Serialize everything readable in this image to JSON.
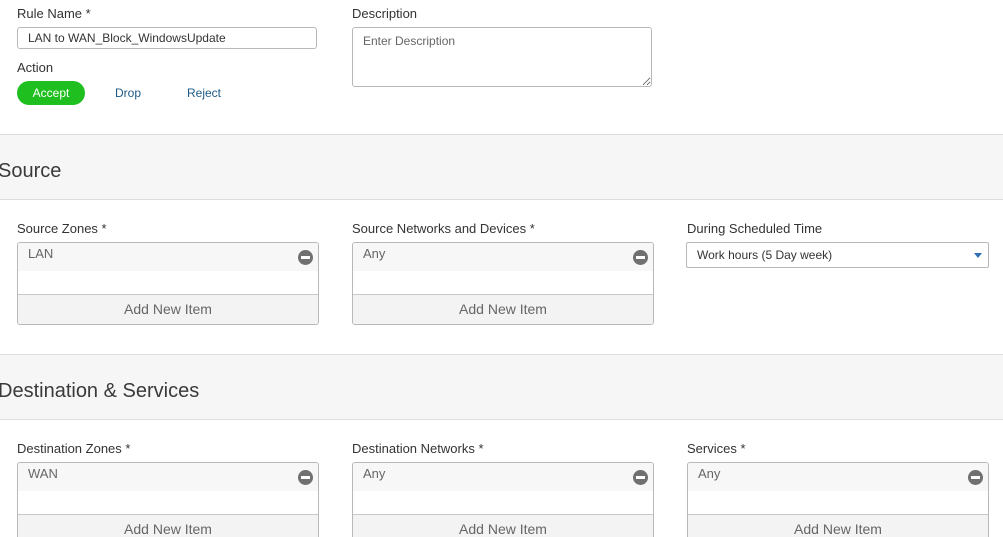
{
  "rule": {
    "name_label": "Rule Name *",
    "name_value": "LAN to WAN_Block_WindowsUpdate",
    "description_label": "Description",
    "description_placeholder": "Enter Description",
    "action_label": "Action",
    "actions": [
      "Accept",
      "Drop",
      "Reject"
    ],
    "selected_action": "Accept"
  },
  "source": {
    "title": "Source",
    "zones": {
      "label": "Source Zones *",
      "items": [
        "LAN"
      ],
      "add_label": "Add New Item"
    },
    "networks": {
      "label": "Source Networks and Devices *",
      "items": [
        "Any"
      ],
      "add_label": "Add New Item"
    },
    "schedule": {
      "label": "During Scheduled Time",
      "value": "Work hours (5 Day week)"
    }
  },
  "destination": {
    "title": "Destination & Services",
    "zones": {
      "label": "Destination Zones *",
      "items": [
        "WAN"
      ],
      "add_label": "Add New Item"
    },
    "networks": {
      "label": "Destination Networks *",
      "items": [
        "Any"
      ],
      "add_label": "Add New Item"
    },
    "services": {
      "label": "Services *",
      "items": [
        "Any"
      ],
      "add_label": "Add New Item"
    }
  },
  "colors": {
    "accent_green": "#1ebf1e",
    "link_blue": "#1f5a85",
    "section_bg": "#f6f6f6"
  }
}
